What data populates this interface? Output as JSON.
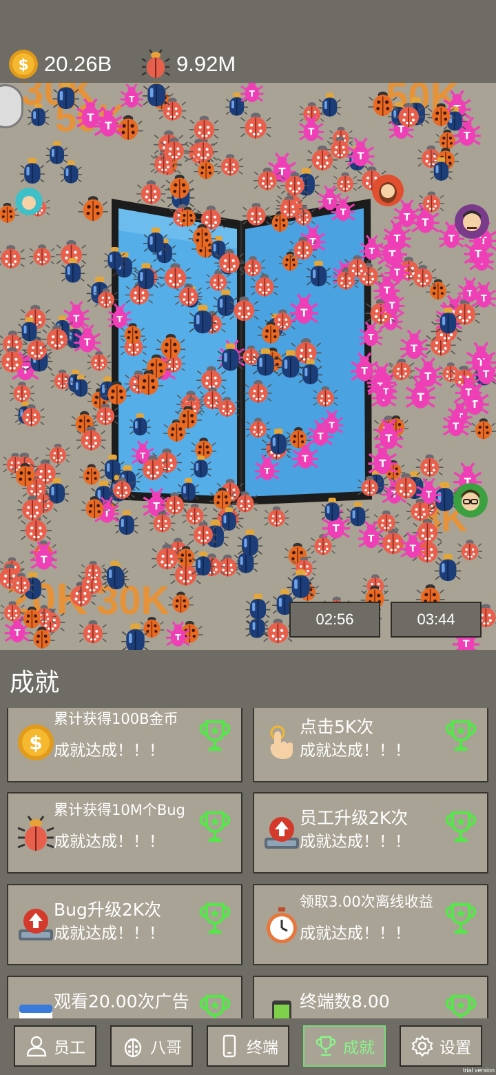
{
  "resources": {
    "gold": "20.26B",
    "bugs": "9.92M"
  },
  "timers": [
    "02:56",
    "03:44"
  ],
  "floating_labels": [
    "30K",
    "50K",
    "20K",
    "30K",
    "8K",
    "50K"
  ],
  "achievements": {
    "title": "成就",
    "items": [
      {
        "name": "累计获得100B金币",
        "status": "成就达成！！！",
        "icon": "gold-coin-icon"
      },
      {
        "name": "点击5K次",
        "status": "成就达成！！！",
        "icon": "tap-finger-icon"
      },
      {
        "name": "累计获得10M个Bug",
        "status": "成就达成！！！",
        "icon": "bug-icon"
      },
      {
        "name": "员工升级2K次",
        "status": "成就达成！！！",
        "icon": "upgrade-icon"
      },
      {
        "name": "Bug升级2K次",
        "status": "成就达成！！！",
        "icon": "upgrade-icon"
      },
      {
        "name": "领取3.00次离线收益",
        "status": "成就达成！！！",
        "icon": "stopwatch-icon"
      },
      {
        "name": "观看20.00次广告",
        "status": "",
        "icon": "ad-calendar-icon"
      },
      {
        "name": "终端数8.00",
        "status": "",
        "icon": "phone-icon"
      }
    ]
  },
  "nav": {
    "tabs": [
      {
        "label": "员工",
        "icon": "person-icon",
        "active": false
      },
      {
        "label": "八哥",
        "icon": "ladybug-icon",
        "active": false
      },
      {
        "label": "终端",
        "icon": "phone-icon",
        "active": false
      },
      {
        "label": "成就",
        "icon": "trophy-icon",
        "active": true
      },
      {
        "label": "设置",
        "icon": "gear-icon",
        "active": false
      }
    ]
  },
  "footer": {
    "trial": "trial version"
  },
  "colors": {
    "panel": "#6e6c64",
    "card": "#a8a394",
    "accent_green": "#78d878",
    "bug_red": "#e8604c",
    "bug_blue": "#1c3d78",
    "bug_pink": "#ee3fb6",
    "label_orange": "#f0902a",
    "screen_blue": "#56aee8"
  }
}
